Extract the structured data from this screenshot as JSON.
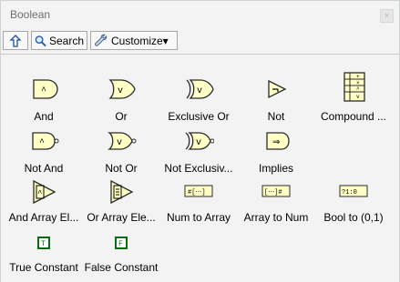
{
  "window": {
    "title": "Boolean",
    "close_glyph": "×"
  },
  "toolbar": {
    "up_icon": "up-arrow-icon",
    "search_label": "Search",
    "search_icon": "magnifier-icon",
    "customize_label": "Customize▾",
    "customize_icon": "wrench-icon"
  },
  "palette": {
    "items": [
      {
        "label": "And",
        "icon": "and-gate-icon"
      },
      {
        "label": "Or",
        "icon": "or-gate-icon"
      },
      {
        "label": "Exclusive Or",
        "icon": "xor-gate-icon"
      },
      {
        "label": "Not",
        "icon": "not-gate-icon"
      },
      {
        "label": "Compound ...",
        "icon": "compound-arithmetic-icon"
      },
      {
        "label": "Not And",
        "icon": "nand-gate-icon"
      },
      {
        "label": "Not Or",
        "icon": "nor-gate-icon"
      },
      {
        "label": "Not Exclusiv...",
        "icon": "xnor-gate-icon"
      },
      {
        "label": "Implies",
        "icon": "implies-gate-icon"
      },
      {
        "label": "And Array El...",
        "icon": "and-array-elements-icon"
      },
      {
        "label": "Or Array Ele...",
        "icon": "or-array-elements-icon"
      },
      {
        "label": "Num to Array",
        "icon": "number-to-boolean-array-icon"
      },
      {
        "label": "Array to Num",
        "icon": "boolean-array-to-number-icon"
      },
      {
        "label": "Bool to (0,1)",
        "icon": "boolean-to-01-icon"
      },
      {
        "label": "True Constant",
        "icon": "true-constant-icon"
      },
      {
        "label": "False Constant",
        "icon": "false-constant-icon"
      }
    ]
  },
  "colors": {
    "window_background": "#f3f3f3",
    "gate_fill": "#ffffc6",
    "gate_stroke": "#2b2b2b",
    "constant_green": "#0b6b12",
    "border": "#c9c9c9"
  }
}
